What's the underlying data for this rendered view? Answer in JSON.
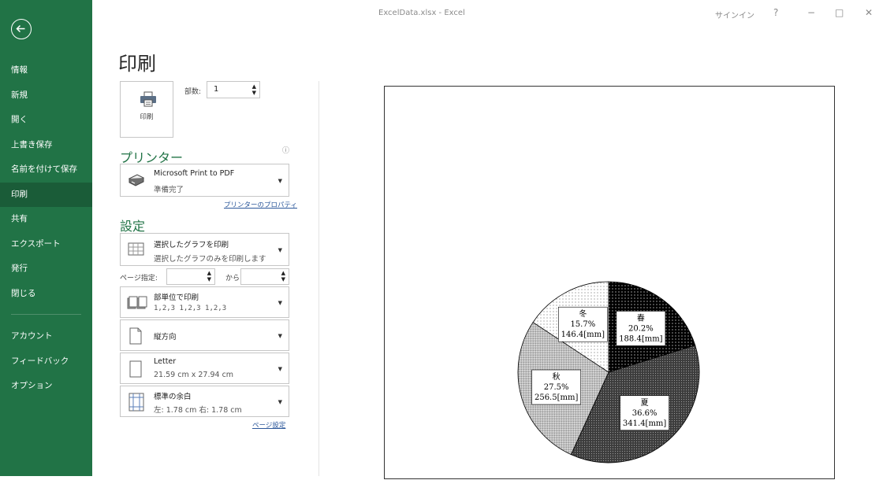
{
  "window": {
    "title": "ExcelData.xlsx - Excel",
    "signin": "サインイン",
    "help": "?",
    "minimize": "−",
    "maximize": "□",
    "close": "✕"
  },
  "sidebar": {
    "items": [
      {
        "label": "情報",
        "active": false
      },
      {
        "label": "新規",
        "active": false
      },
      {
        "label": "開く",
        "active": false
      },
      {
        "label": "上書き保存",
        "active": false
      },
      {
        "label": "名前を付けて保存",
        "active": false
      },
      {
        "label": "印刷",
        "active": true
      },
      {
        "label": "共有",
        "active": false
      },
      {
        "label": "エクスポート",
        "active": false
      },
      {
        "label": "発行",
        "active": false
      },
      {
        "label": "閉じる",
        "active": false
      }
    ],
    "bottom_items": [
      {
        "label": "アカウント"
      },
      {
        "label": "フィードバック"
      },
      {
        "label": "オプション"
      }
    ]
  },
  "print": {
    "heading": "印刷",
    "button_label": "印刷",
    "copies_label": "部数:",
    "copies_value": "1"
  },
  "printer": {
    "section_title": "プリンター",
    "name": "Microsoft Print to PDF",
    "status": "準備完了",
    "properties_link": "プリンターのプロパティ"
  },
  "settings": {
    "section_title": "設定",
    "scope": {
      "line1": "選択したグラフを印刷",
      "line2": "選択したグラフのみを印刷します"
    },
    "pages_label": "ページ指定:",
    "pages_from": "",
    "pages_sep": "から",
    "pages_to": "",
    "collate": {
      "line1": "部単位で印刷",
      "line2": "1,2,3    1,2,3    1,2,3"
    },
    "orientation": {
      "line1": "縦方向"
    },
    "paper": {
      "line1": "Letter",
      "line2": "21.59 cm x 27.94 cm"
    },
    "margins": {
      "line1": "標準の余白",
      "line2": "左:  1.78 cm    右:  1.78 cm"
    },
    "page_setup_link": "ページ設定"
  },
  "colors": {
    "sidebar": "#217346",
    "sidebar_active": "#1a5c38",
    "accent": "#217346",
    "link": "#2b579a"
  },
  "chart_data": {
    "type": "pie",
    "slices": [
      {
        "season": "春",
        "percent": "20.2%",
        "amount": "188.4[mm]",
        "value": 188.4,
        "pattern": "black-dots"
      },
      {
        "season": "夏",
        "percent": "36.6%",
        "amount": "341.4[mm]",
        "value": 341.4,
        "pattern": "dark-dots"
      },
      {
        "season": "秋",
        "percent": "27.5%",
        "amount": "256.5[mm]",
        "value": 256.5,
        "pattern": "gray-dots"
      },
      {
        "season": "冬",
        "percent": "15.7%",
        "amount": "146.4[mm]",
        "value": 146.4,
        "pattern": "light-dots"
      }
    ]
  }
}
